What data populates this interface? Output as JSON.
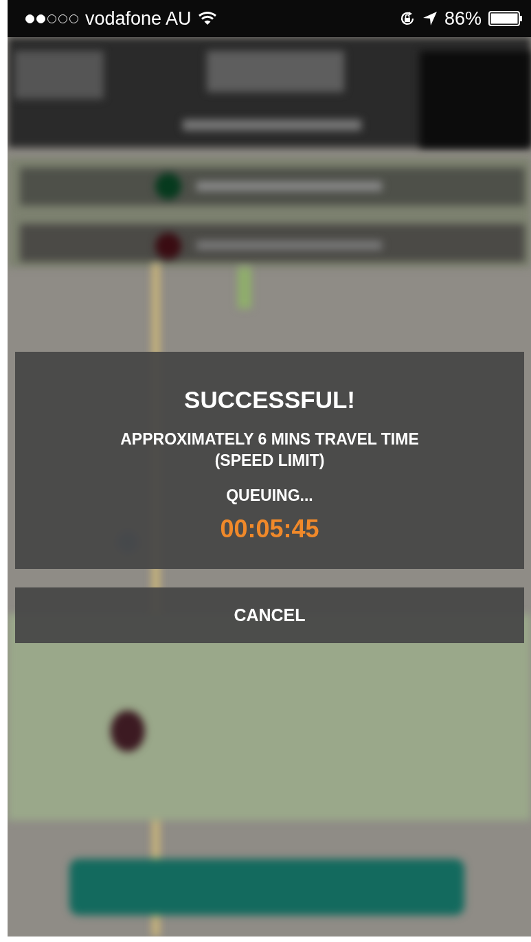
{
  "status_bar": {
    "carrier": "vodafone AU",
    "battery": "86%"
  },
  "dialog": {
    "title": "SUCCESSFUL!",
    "message": "APPROXIMATELY 6 MINS TRAVEL TIME\n(SPEED LIMIT)",
    "status": "QUEUING...",
    "timer": "00:05:45"
  },
  "buttons": [
    {
      "label": "CANCEL"
    }
  ]
}
